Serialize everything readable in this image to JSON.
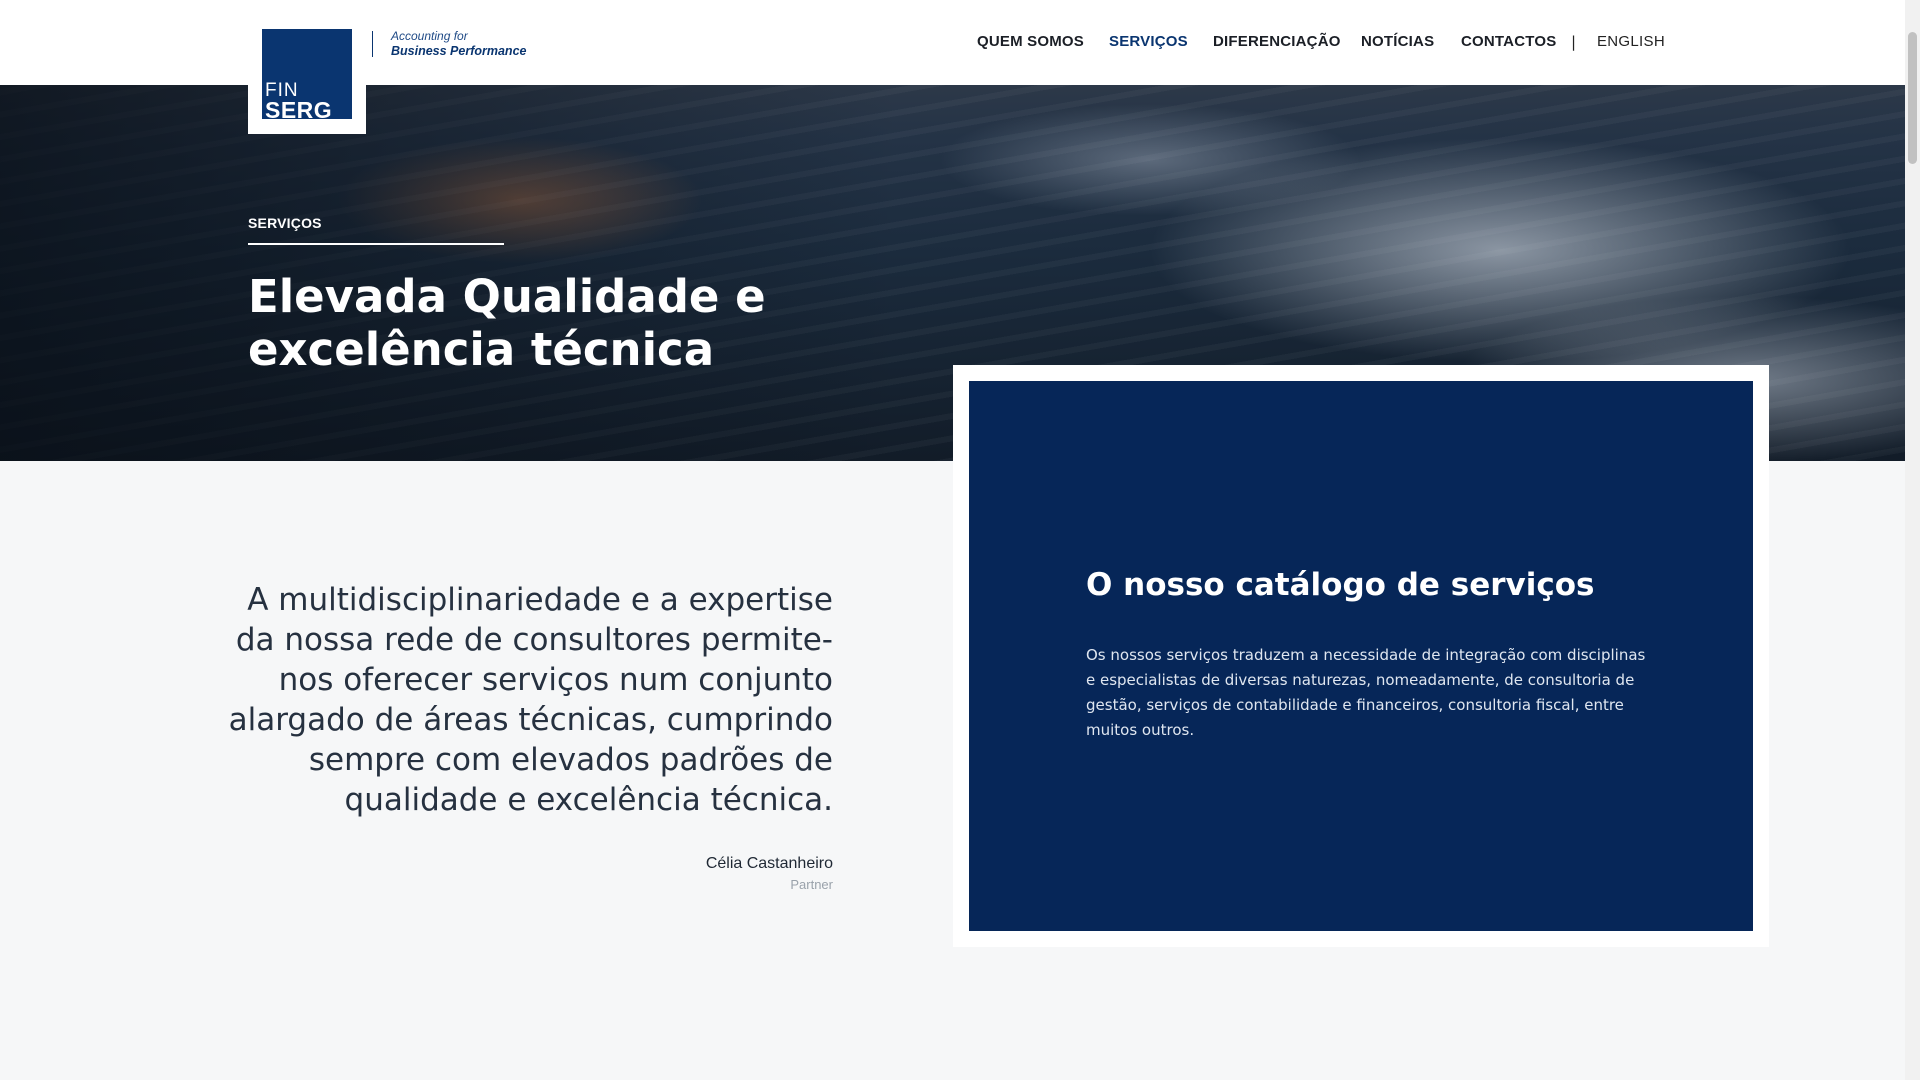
{
  "brand": {
    "logo_line1": "FIN",
    "logo_line2": "SERG",
    "tagline_line1": "Accounting for",
    "tagline_line2": "Business Performance",
    "color_primary": "#0a3570",
    "color_card": "#062658"
  },
  "nav": {
    "items": [
      {
        "label": "QUEM SOMOS",
        "active": false
      },
      {
        "label": "SERVIÇOS",
        "active": true
      },
      {
        "label": "DIFERENCIAÇÃO",
        "active": false
      },
      {
        "label": "NOTÍCIAS",
        "active": false
      },
      {
        "label": "CONTACTOS",
        "active": false
      }
    ],
    "separator": "|",
    "language": "ENGLISH"
  },
  "hero": {
    "eyebrow": "SERVIÇOS",
    "title": "Elevada Qualidade e excelência técnica"
  },
  "quote": {
    "text": "A multidisciplinariedade e a expertise da nossa rede de consultores permite-nos oferecer serviços num conjunto alargado de áreas técnicas, cumprindo sempre com elevados padrões de qualidade e excelência técnica.",
    "author": "Célia Castanheiro",
    "role": "Partner"
  },
  "catalog": {
    "title": "O nosso catálogo de serviços",
    "text": "Os nossos serviços traduzem a necessidade de integração com disciplinas e especialistas de diversas naturezas, nomeadamente, de consultoria de gestão, serviços de contabilidade e financeiros, consultoria fiscal, entre muitos outros."
  }
}
